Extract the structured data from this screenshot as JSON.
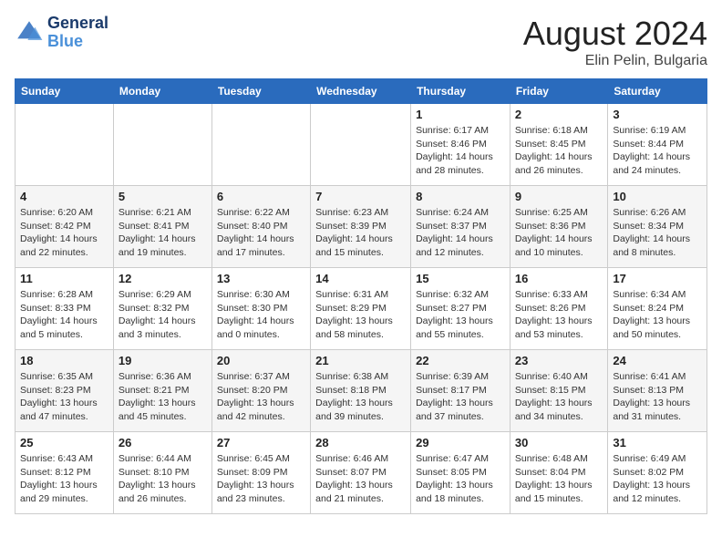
{
  "header": {
    "logo_line1": "General",
    "logo_line2": "Blue",
    "month": "August 2024",
    "location": "Elin Pelin, Bulgaria"
  },
  "weekdays": [
    "Sunday",
    "Monday",
    "Tuesday",
    "Wednesday",
    "Thursday",
    "Friday",
    "Saturday"
  ],
  "weeks": [
    [
      {
        "day": "",
        "detail": ""
      },
      {
        "day": "",
        "detail": ""
      },
      {
        "day": "",
        "detail": ""
      },
      {
        "day": "",
        "detail": ""
      },
      {
        "day": "1",
        "detail": "Sunrise: 6:17 AM\nSunset: 8:46 PM\nDaylight: 14 hours\nand 28 minutes."
      },
      {
        "day": "2",
        "detail": "Sunrise: 6:18 AM\nSunset: 8:45 PM\nDaylight: 14 hours\nand 26 minutes."
      },
      {
        "day": "3",
        "detail": "Sunrise: 6:19 AM\nSunset: 8:44 PM\nDaylight: 14 hours\nand 24 minutes."
      }
    ],
    [
      {
        "day": "4",
        "detail": "Sunrise: 6:20 AM\nSunset: 8:42 PM\nDaylight: 14 hours\nand 22 minutes."
      },
      {
        "day": "5",
        "detail": "Sunrise: 6:21 AM\nSunset: 8:41 PM\nDaylight: 14 hours\nand 19 minutes."
      },
      {
        "day": "6",
        "detail": "Sunrise: 6:22 AM\nSunset: 8:40 PM\nDaylight: 14 hours\nand 17 minutes."
      },
      {
        "day": "7",
        "detail": "Sunrise: 6:23 AM\nSunset: 8:39 PM\nDaylight: 14 hours\nand 15 minutes."
      },
      {
        "day": "8",
        "detail": "Sunrise: 6:24 AM\nSunset: 8:37 PM\nDaylight: 14 hours\nand 12 minutes."
      },
      {
        "day": "9",
        "detail": "Sunrise: 6:25 AM\nSunset: 8:36 PM\nDaylight: 14 hours\nand 10 minutes."
      },
      {
        "day": "10",
        "detail": "Sunrise: 6:26 AM\nSunset: 8:34 PM\nDaylight: 14 hours\nand 8 minutes."
      }
    ],
    [
      {
        "day": "11",
        "detail": "Sunrise: 6:28 AM\nSunset: 8:33 PM\nDaylight: 14 hours\nand 5 minutes."
      },
      {
        "day": "12",
        "detail": "Sunrise: 6:29 AM\nSunset: 8:32 PM\nDaylight: 14 hours\nand 3 minutes."
      },
      {
        "day": "13",
        "detail": "Sunrise: 6:30 AM\nSunset: 8:30 PM\nDaylight: 14 hours\nand 0 minutes."
      },
      {
        "day": "14",
        "detail": "Sunrise: 6:31 AM\nSunset: 8:29 PM\nDaylight: 13 hours\nand 58 minutes."
      },
      {
        "day": "15",
        "detail": "Sunrise: 6:32 AM\nSunset: 8:27 PM\nDaylight: 13 hours\nand 55 minutes."
      },
      {
        "day": "16",
        "detail": "Sunrise: 6:33 AM\nSunset: 8:26 PM\nDaylight: 13 hours\nand 53 minutes."
      },
      {
        "day": "17",
        "detail": "Sunrise: 6:34 AM\nSunset: 8:24 PM\nDaylight: 13 hours\nand 50 minutes."
      }
    ],
    [
      {
        "day": "18",
        "detail": "Sunrise: 6:35 AM\nSunset: 8:23 PM\nDaylight: 13 hours\nand 47 minutes."
      },
      {
        "day": "19",
        "detail": "Sunrise: 6:36 AM\nSunset: 8:21 PM\nDaylight: 13 hours\nand 45 minutes."
      },
      {
        "day": "20",
        "detail": "Sunrise: 6:37 AM\nSunset: 8:20 PM\nDaylight: 13 hours\nand 42 minutes."
      },
      {
        "day": "21",
        "detail": "Sunrise: 6:38 AM\nSunset: 8:18 PM\nDaylight: 13 hours\nand 39 minutes."
      },
      {
        "day": "22",
        "detail": "Sunrise: 6:39 AM\nSunset: 8:17 PM\nDaylight: 13 hours\nand 37 minutes."
      },
      {
        "day": "23",
        "detail": "Sunrise: 6:40 AM\nSunset: 8:15 PM\nDaylight: 13 hours\nand 34 minutes."
      },
      {
        "day": "24",
        "detail": "Sunrise: 6:41 AM\nSunset: 8:13 PM\nDaylight: 13 hours\nand 31 minutes."
      }
    ],
    [
      {
        "day": "25",
        "detail": "Sunrise: 6:43 AM\nSunset: 8:12 PM\nDaylight: 13 hours\nand 29 minutes."
      },
      {
        "day": "26",
        "detail": "Sunrise: 6:44 AM\nSunset: 8:10 PM\nDaylight: 13 hours\nand 26 minutes."
      },
      {
        "day": "27",
        "detail": "Sunrise: 6:45 AM\nSunset: 8:09 PM\nDaylight: 13 hours\nand 23 minutes."
      },
      {
        "day": "28",
        "detail": "Sunrise: 6:46 AM\nSunset: 8:07 PM\nDaylight: 13 hours\nand 21 minutes."
      },
      {
        "day": "29",
        "detail": "Sunrise: 6:47 AM\nSunset: 8:05 PM\nDaylight: 13 hours\nand 18 minutes."
      },
      {
        "day": "30",
        "detail": "Sunrise: 6:48 AM\nSunset: 8:04 PM\nDaylight: 13 hours\nand 15 minutes."
      },
      {
        "day": "31",
        "detail": "Sunrise: 6:49 AM\nSunset: 8:02 PM\nDaylight: 13 hours\nand 12 minutes."
      }
    ]
  ]
}
